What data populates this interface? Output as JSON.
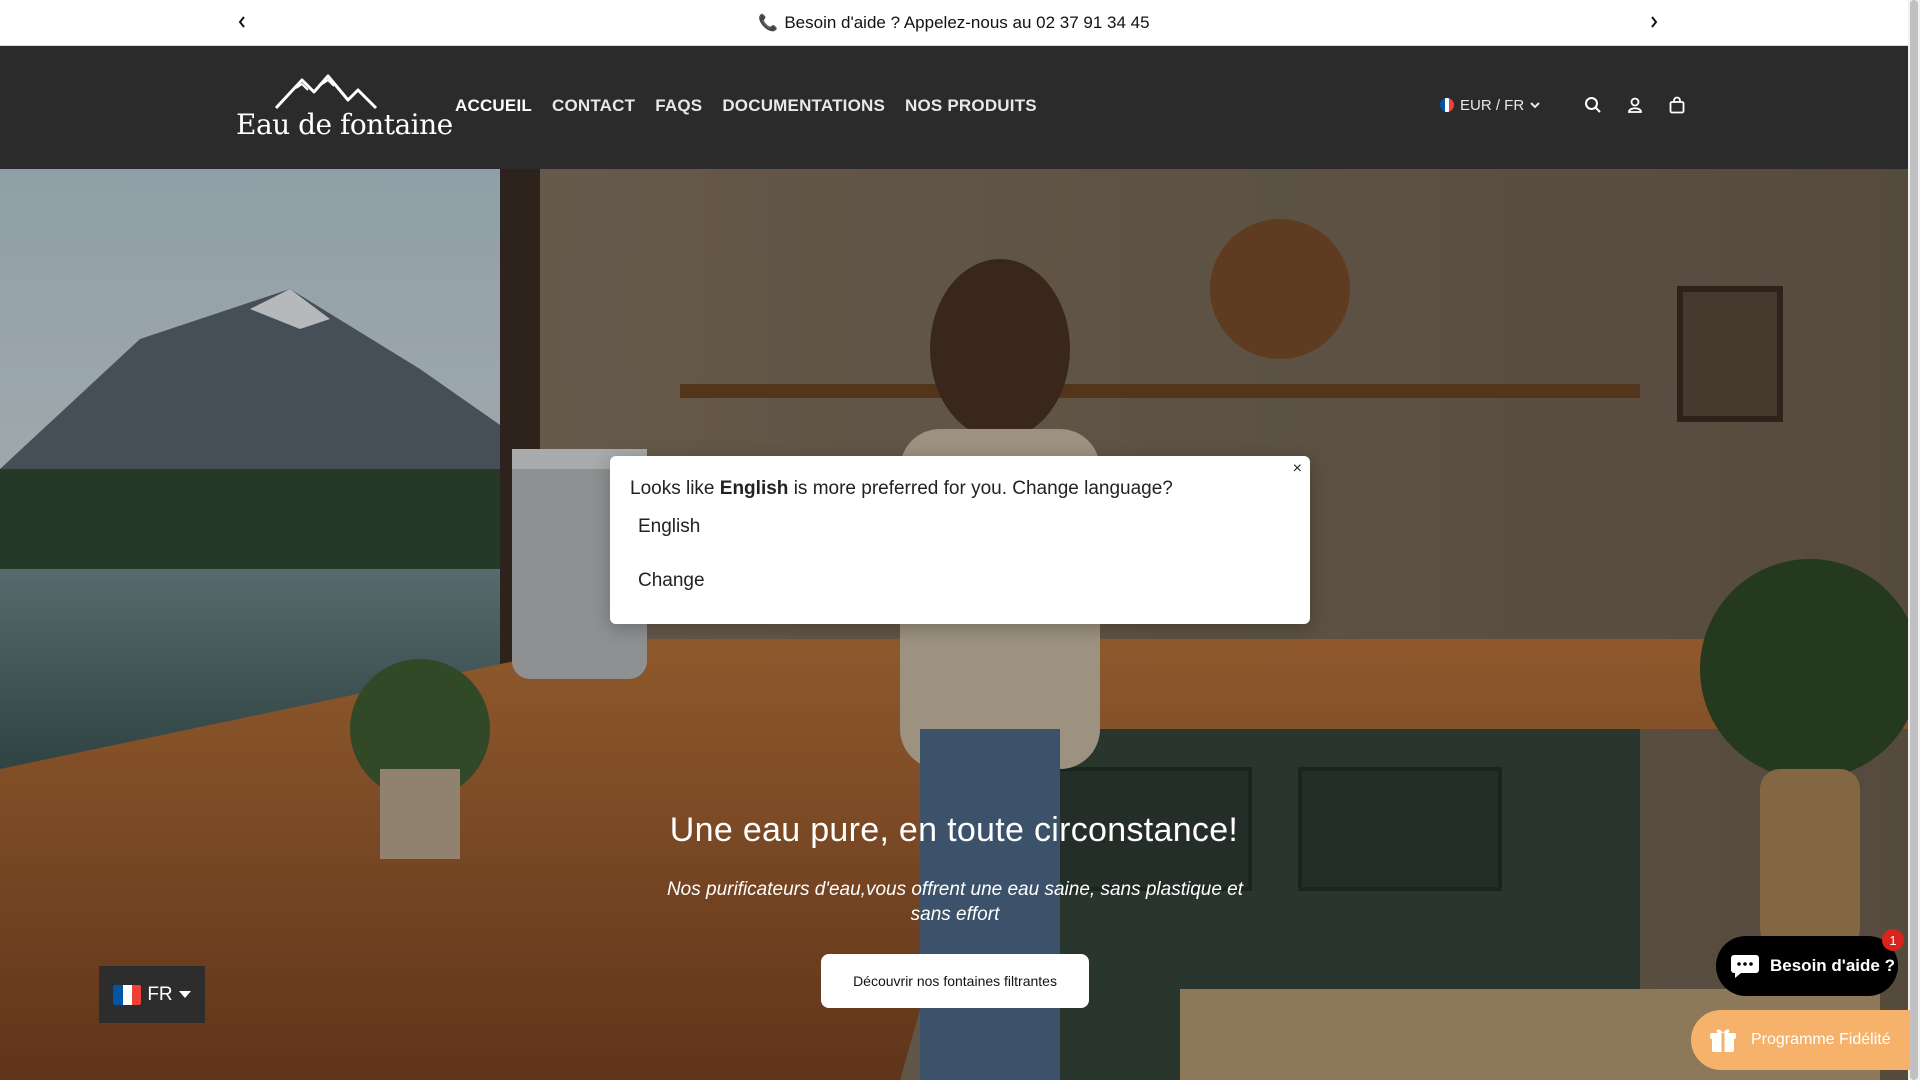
{
  "announcement": {
    "text": "Besoin d'aide ? Appelez-nous au 02 37 91 34 45",
    "icon": "phone-icon"
  },
  "header": {
    "logo_text": "Eau de fontaine",
    "nav": [
      {
        "label": "ACCUEIL"
      },
      {
        "label": "CONTACT"
      },
      {
        "label": "FAQS"
      },
      {
        "label": "DOCUMENTATIONS"
      },
      {
        "label": "NOS PRODUITS"
      }
    ],
    "locale": "EUR / FR"
  },
  "hero": {
    "title": "Une eau pure, en toute circonstance!",
    "subtitle": "Nos purificateurs d'eau,vous offrent une eau saine, sans plastique et sans effort",
    "cta": "Découvrir nos fontaines filtrantes"
  },
  "language_popup": {
    "msg_prefix": "Looks like",
    "msg_lang": "English",
    "msg_suffix": "is more preferred for you. Change language?",
    "option": "English",
    "change": "Change",
    "close": "×"
  },
  "language_switcher": {
    "label": "FR"
  },
  "chat": {
    "label": "Besoin d'aide ?",
    "badge": "1"
  },
  "loyalty": {
    "label": "Programme Fidélité"
  },
  "colors": {
    "header_bg": "#2b2b2b",
    "loyalty": "#f6b26b",
    "chat": "#000000",
    "flag_blue": "#0055a4",
    "flag_white": "#ffffff",
    "flag_red": "#ef4135"
  }
}
